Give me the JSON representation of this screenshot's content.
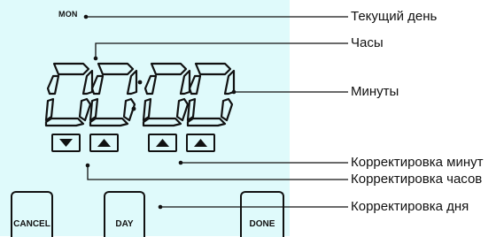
{
  "display": {
    "day": "MON",
    "time": "00:00"
  },
  "adjust_buttons": [
    {
      "direction": "down",
      "icon": "down-triangle-icon"
    },
    {
      "direction": "up",
      "icon": "up-triangle-icon"
    },
    {
      "direction": "up",
      "icon": "up-triangle-icon"
    },
    {
      "direction": "up",
      "icon": "up-triangle-icon"
    }
  ],
  "buttons": {
    "cancel": "CANCEL",
    "day": "DAY",
    "done": "DONE"
  },
  "callouts": {
    "current_day": "Текущий день",
    "hours": "Часы",
    "minutes": "Минуты",
    "adjust_minutes": "Корректировка минут",
    "adjust_hours": "Корректировка часов",
    "adjust_day": "Корректировка дня"
  },
  "colors": {
    "panel": "#dffafb",
    "ink": "#111111"
  }
}
